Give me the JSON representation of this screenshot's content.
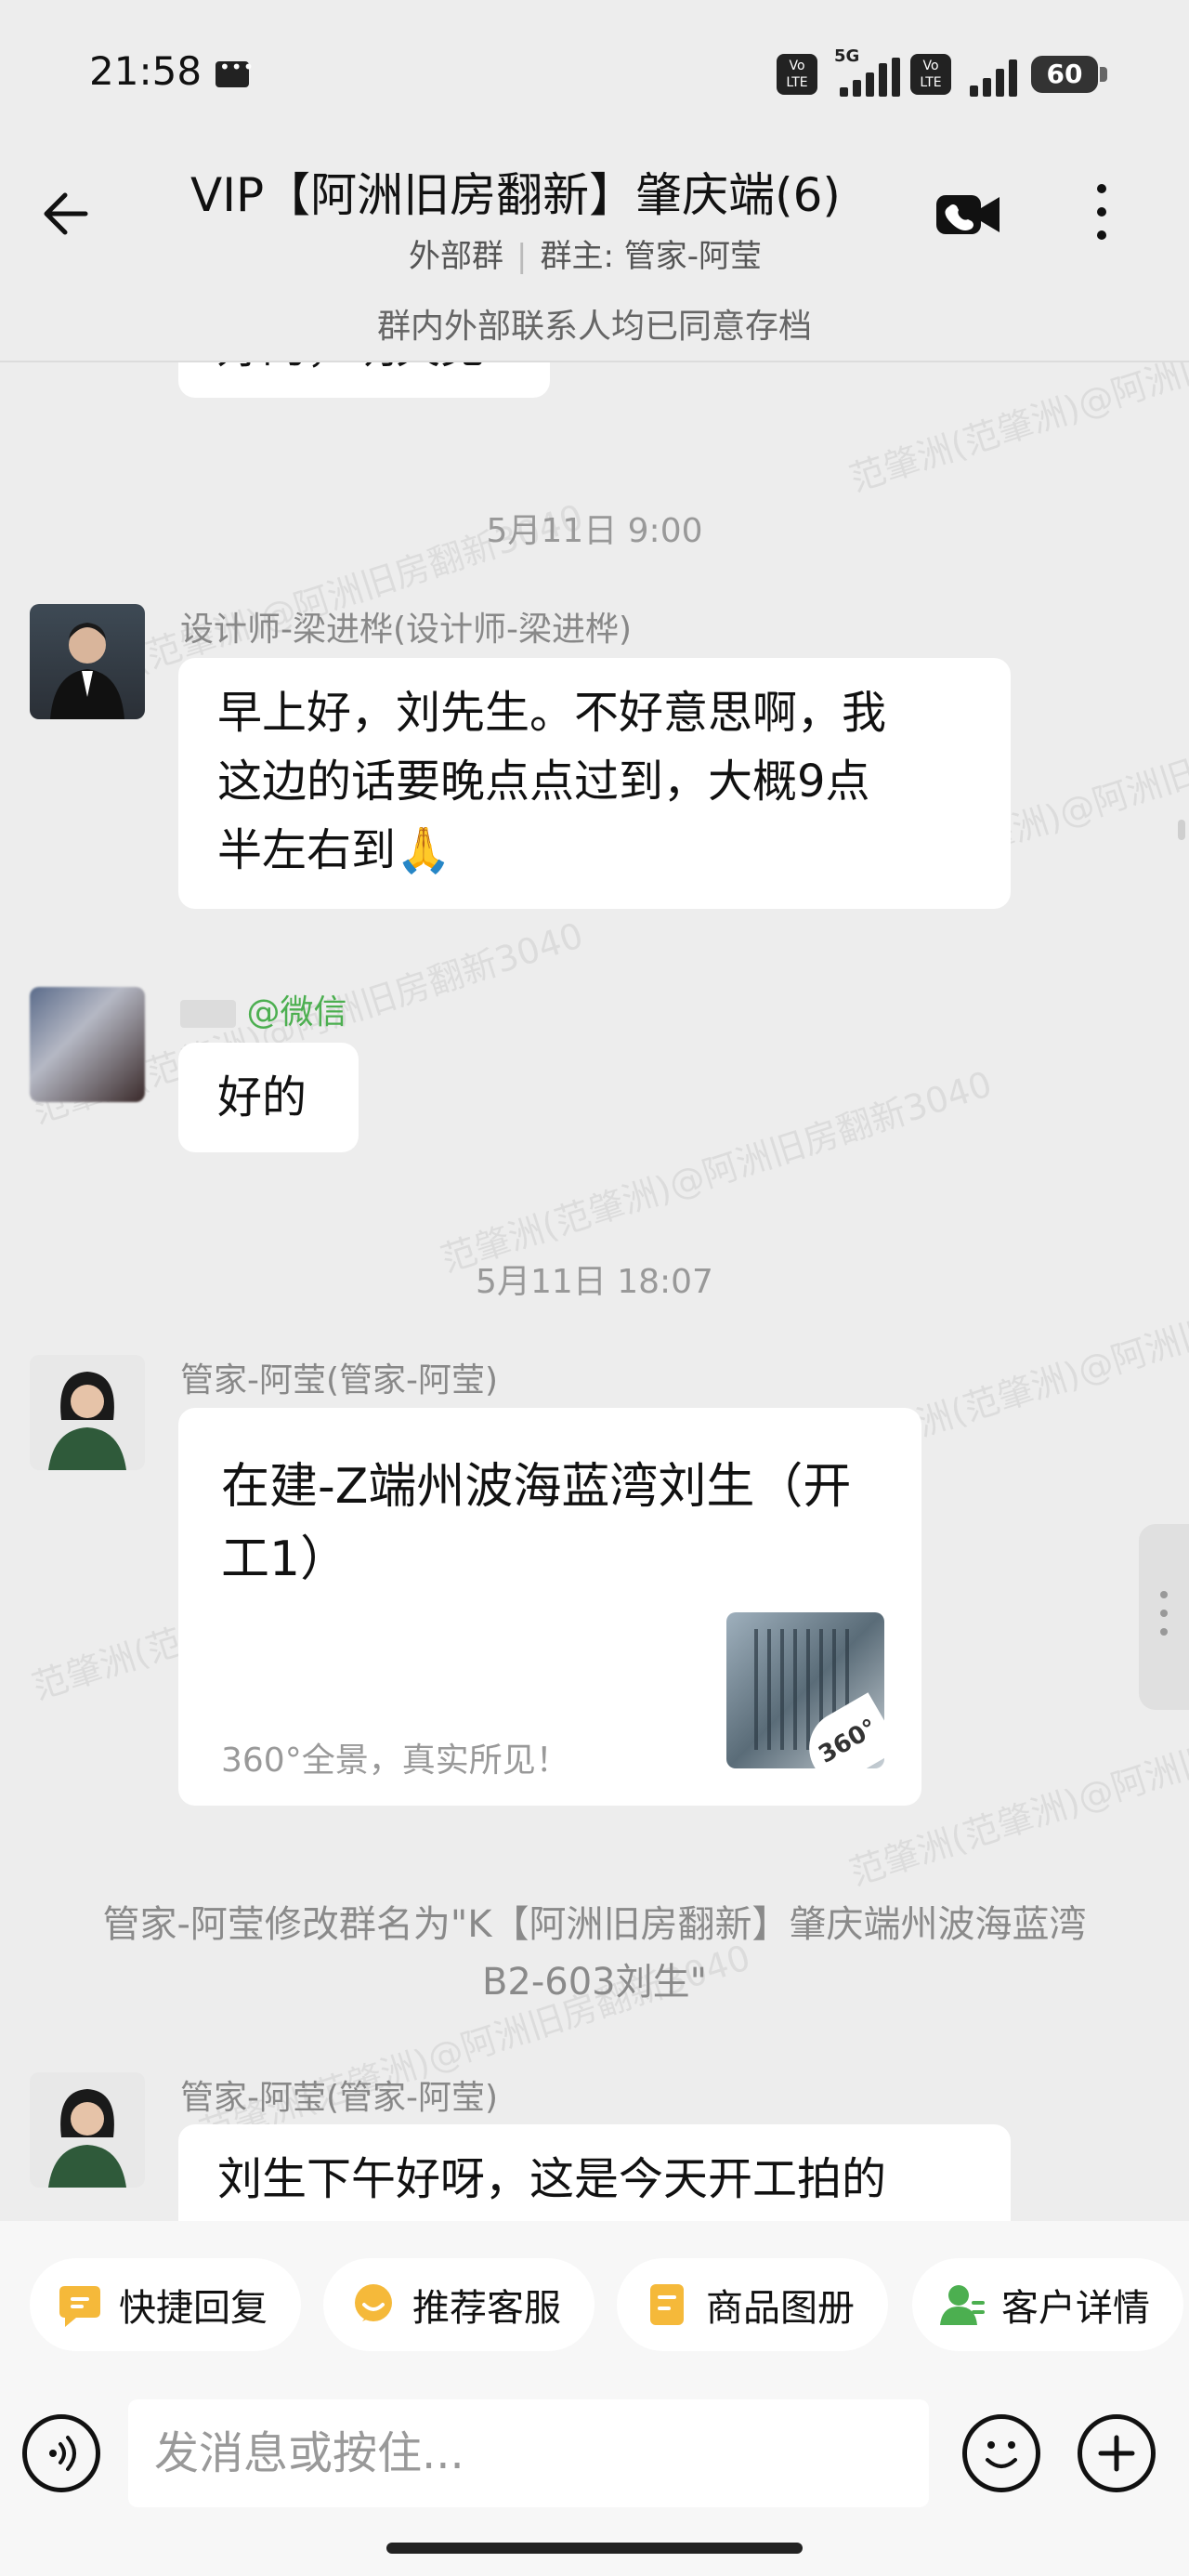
{
  "status_bar": {
    "time": "21:58",
    "battery": "60",
    "network": "5G",
    "volte_label": "Vo LTE"
  },
  "header": {
    "title": "VIP【阿洲旧房翻新】肇庆端(6)",
    "group_type": "外部群",
    "group_owner": "群主: 管家-阿莹",
    "archive_note": "群内外部联系人均已同意存档"
  },
  "watermark": "范肇洲(范肇洲)@阿洲旧房翻新3040",
  "chat": {
    "partial_top_text": "好的，明天见",
    "timestamp_1": "5月11日  9:00",
    "msg1": {
      "sender": "设计师-梁进桦(设计师-梁进桦)",
      "line1": "早上好，刘先生。不好意思啊，我",
      "line2": "这边的话要晚点点过到，大概9点",
      "line3": "半左右到🙏"
    },
    "msg2": {
      "sender_suffix": "@微信",
      "text": "好的"
    },
    "timestamp_2": "5月11日  18:07",
    "msg3": {
      "sender": "管家-阿莹(管家-阿莹)",
      "card_title": "在建-Z端州波海蓝湾刘生（开工1）",
      "card_desc": "360°全景，真实所见！",
      "card_badge": "360°"
    },
    "system_note": "管家-阿莹修改群名为\"K【阿洲旧房翻新】肇庆端州波海蓝湾B2-603刘生\"",
    "msg4": {
      "sender": "管家-阿莹(管家-阿莹)",
      "text": "刘生下午好呀，这是今天开工拍的"
    }
  },
  "quick_actions": [
    {
      "label": "快捷回复",
      "icon": "quick-reply-icon",
      "color": "#F5B93A"
    },
    {
      "label": "推荐客服",
      "icon": "recommend-service-icon",
      "color": "#F5B93A"
    },
    {
      "label": "商品图册",
      "icon": "product-album-icon",
      "color": "#F5B93A"
    },
    {
      "label": "客户详情",
      "icon": "customer-detail-icon",
      "color": "#4CAF50"
    }
  ],
  "input": {
    "placeholder": "发消息或按住..."
  }
}
